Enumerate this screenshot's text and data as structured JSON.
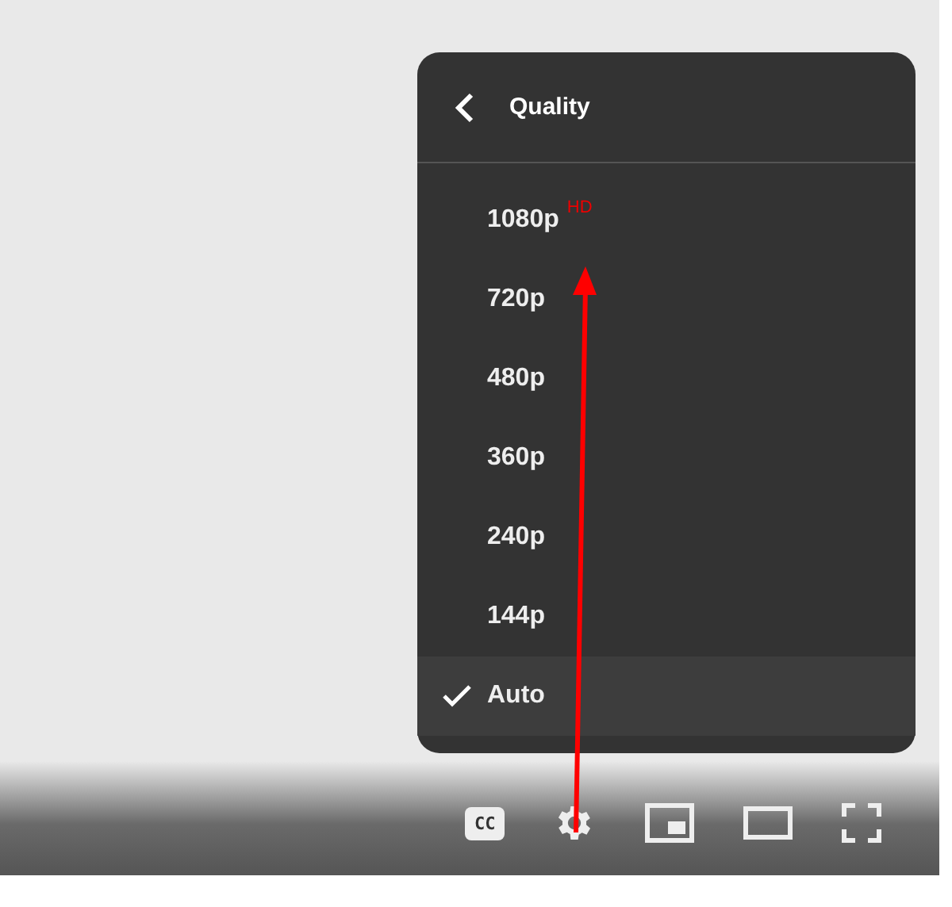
{
  "quality_menu": {
    "title": "Quality",
    "options": [
      {
        "label": "1080p",
        "badge": "HD",
        "selected": false
      },
      {
        "label": "720p",
        "selected": false
      },
      {
        "label": "480p",
        "selected": false
      },
      {
        "label": "360p",
        "selected": false
      },
      {
        "label": "240p",
        "selected": false
      },
      {
        "label": "144p",
        "selected": false
      },
      {
        "label": "Auto",
        "selected": true
      }
    ]
  },
  "controls": [
    {
      "kind": "captions",
      "label": "CC"
    },
    {
      "kind": "settings"
    },
    {
      "kind": "miniplayer"
    },
    {
      "kind": "theater"
    },
    {
      "kind": "fullscreen"
    }
  ]
}
